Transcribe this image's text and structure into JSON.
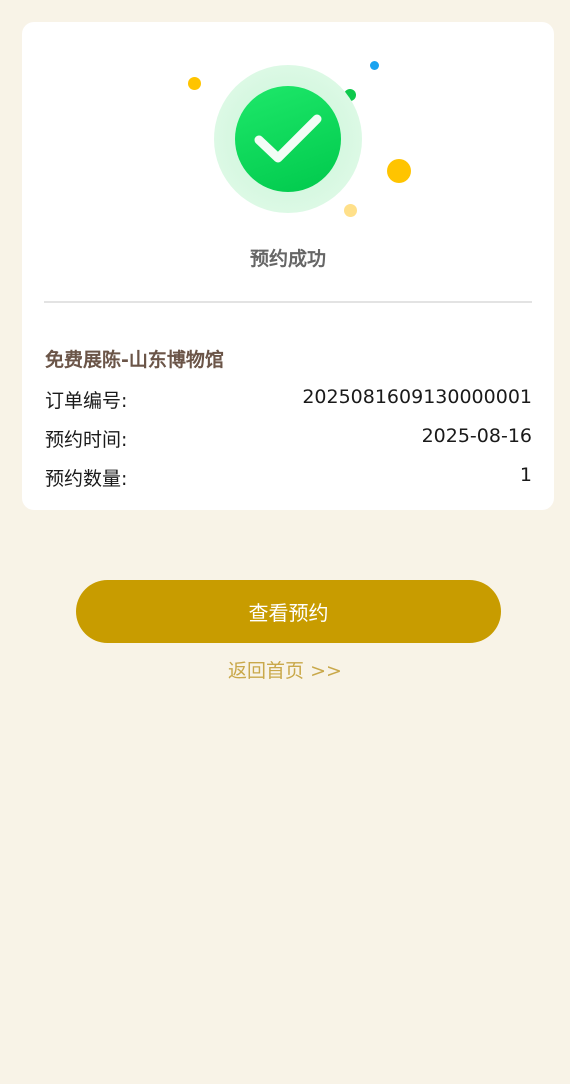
{
  "result": {
    "title": "预约成功",
    "colors": {
      "success_green": "#00c94c",
      "accent_gold": "#c89c00",
      "link_gold": "#c9a84a",
      "page_bg": "#f8f3e7"
    },
    "icon": "check-circle-icon"
  },
  "order": {
    "exhibit_name": "免费展陈-山东博物馆",
    "fields": [
      {
        "label": "订单编号:",
        "value": "2025081609130000001"
      },
      {
        "label": "预约时间:",
        "value": "2025-08-16"
      },
      {
        "label": "预约数量:",
        "value": "1"
      }
    ]
  },
  "actions": {
    "view_label": "查看预约",
    "home_label": "返回首页 >>"
  }
}
